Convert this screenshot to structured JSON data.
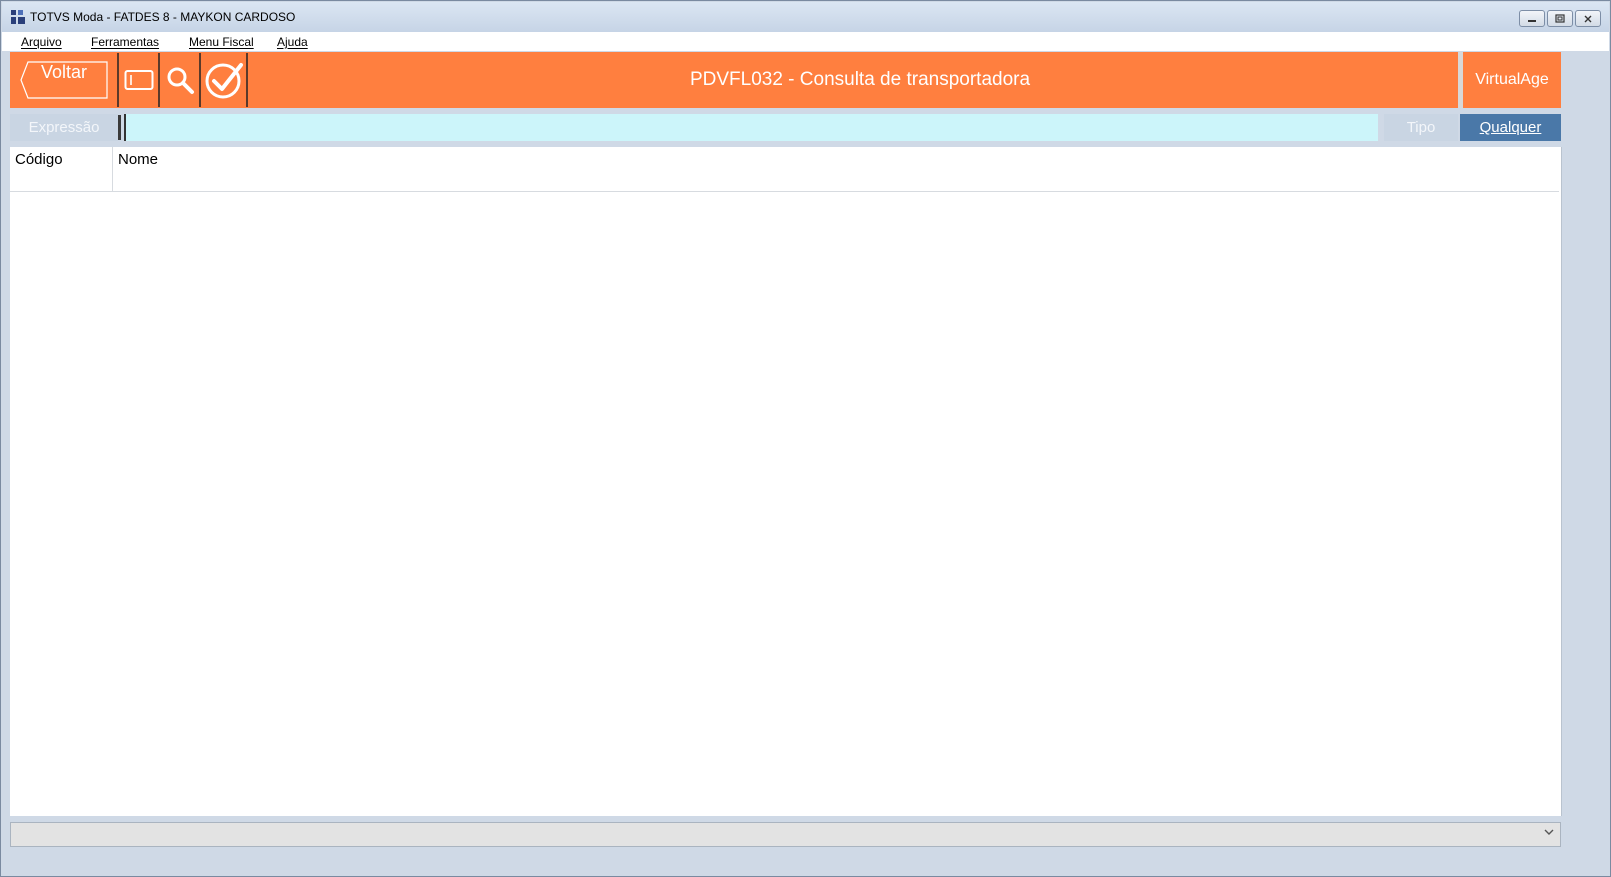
{
  "window": {
    "title": "TOTVS Moda - FATDES 8 - MAYKON CARDOSO",
    "minimize_glyph": "▭",
    "restore_glyph": "▣",
    "close_glyph": "✕"
  },
  "menu": {
    "items": [
      "Arquivo",
      "Ferramentas",
      "Menu Fiscal",
      "Ajuda"
    ]
  },
  "toolbar": {
    "back_label": "Voltar",
    "page_title": "PDVFL032 - Consulta de transportadora",
    "brand_label": "VirtualAge",
    "icons": [
      "card-icon",
      "search-icon",
      "check-circle-icon"
    ],
    "accent_color": "#ff7f3f"
  },
  "filter": {
    "expression_label": "Expressão",
    "search_value": "",
    "type_label": "Tipo",
    "type_value": "Qualquer"
  },
  "grid": {
    "columns": [
      "Código",
      "Nome"
    ],
    "rows": []
  },
  "statusbar": {
    "text": ""
  }
}
